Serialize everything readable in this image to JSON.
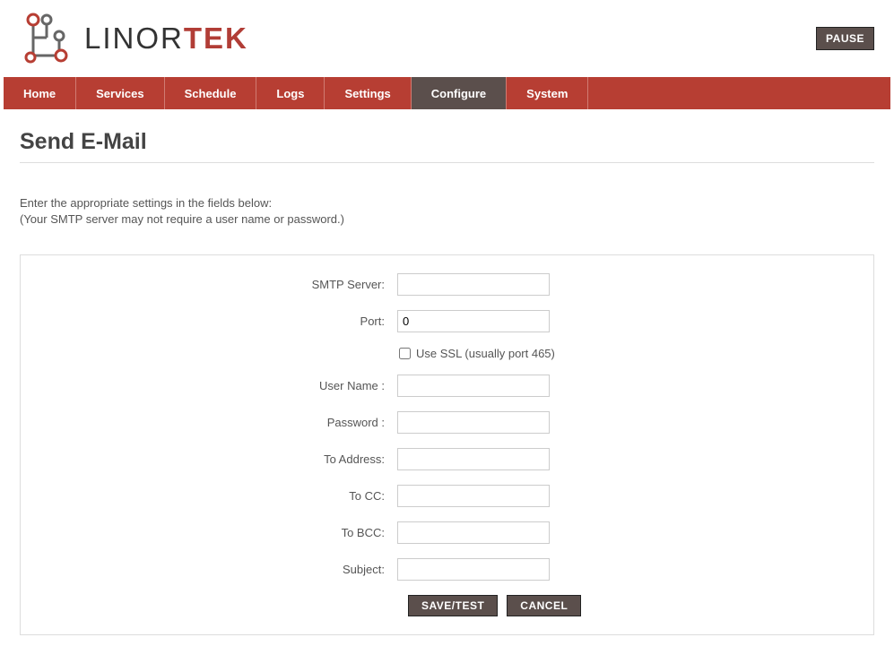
{
  "header": {
    "brand_prefix": "LINOR",
    "brand_suffix": "TEK",
    "pause_label": "PAUSE"
  },
  "nav": {
    "items": [
      {
        "label": "Home",
        "active": false
      },
      {
        "label": "Services",
        "active": false
      },
      {
        "label": "Schedule",
        "active": false
      },
      {
        "label": "Logs",
        "active": false
      },
      {
        "label": "Settings",
        "active": false
      },
      {
        "label": "Configure",
        "active": true
      },
      {
        "label": "System",
        "active": false
      }
    ]
  },
  "page": {
    "title": "Send E-Mail",
    "intro_line1": "Enter the appropriate settings in the fields below:",
    "intro_line2": "(Your SMTP server may not require a user name or password.)"
  },
  "form": {
    "smtp_server": {
      "label": "SMTP Server:",
      "value": ""
    },
    "port": {
      "label": "Port:",
      "value": "0"
    },
    "use_ssl": {
      "label": "Use SSL (usually port 465)",
      "checked": false
    },
    "user_name": {
      "label": "User Name :",
      "value": ""
    },
    "password": {
      "label": "Password :",
      "value": ""
    },
    "to_address": {
      "label": "To Address:",
      "value": ""
    },
    "to_cc": {
      "label": "To CC:",
      "value": ""
    },
    "to_bcc": {
      "label": "To BCC:",
      "value": ""
    },
    "subject": {
      "label": "Subject:",
      "value": ""
    }
  },
  "buttons": {
    "save_test": "SAVE/TEST",
    "cancel": "CANCEL"
  }
}
